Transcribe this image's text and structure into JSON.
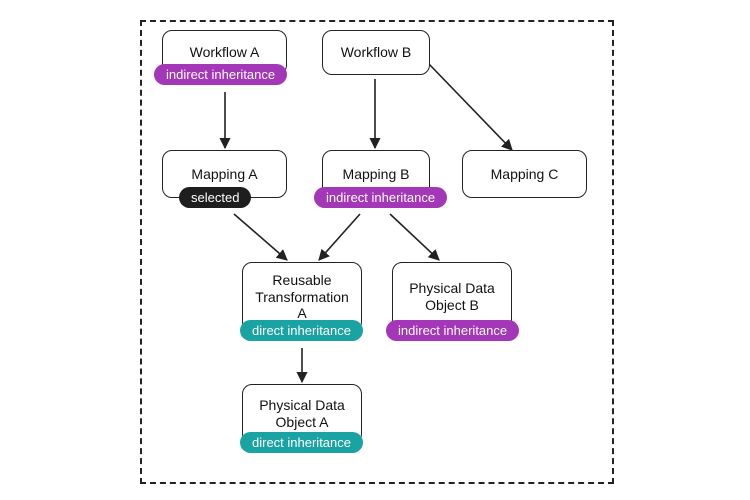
{
  "diagram": {
    "nodes": {
      "workflow_a": "Workflow A",
      "workflow_b": "Workflow B",
      "mapping_a": "Mapping A",
      "mapping_b": "Mapping B",
      "mapping_c": "Mapping C",
      "reusable_transformation_a": "Reusable Transformation A",
      "physical_data_object_b": "Physical Data Object B",
      "physical_data_object_a": "Physical Data Object A"
    },
    "badges": {
      "indirect_inheritance": "indirect inheritance",
      "selected": "selected",
      "direct_inheritance": "direct inheritance"
    }
  },
  "chart_data": {
    "type": "diagram",
    "title": "",
    "edges": [
      {
        "from": "Workflow A",
        "to": "Mapping A"
      },
      {
        "from": "Workflow B",
        "to": "Mapping B"
      },
      {
        "from": "Workflow B",
        "to": "Mapping C"
      },
      {
        "from": "Mapping A",
        "to": "Reusable Transformation A"
      },
      {
        "from": "Mapping B",
        "to": "Reusable Transformation A"
      },
      {
        "from": "Mapping B",
        "to": "Physical Data Object B"
      },
      {
        "from": "Reusable Transformation A",
        "to": "Physical Data Object A"
      }
    ],
    "node_annotations": [
      {
        "node": "Workflow A",
        "badge": "indirect inheritance",
        "color": "purple"
      },
      {
        "node": "Mapping A",
        "badge": "selected",
        "color": "black"
      },
      {
        "node": "Mapping B",
        "badge": "indirect inheritance",
        "color": "purple"
      },
      {
        "node": "Reusable Transformation A",
        "badge": "direct inheritance",
        "color": "teal"
      },
      {
        "node": "Physical Data Object B",
        "badge": "indirect inheritance",
        "color": "purple"
      },
      {
        "node": "Physical Data Object A",
        "badge": "direct inheritance",
        "color": "teal"
      }
    ]
  }
}
